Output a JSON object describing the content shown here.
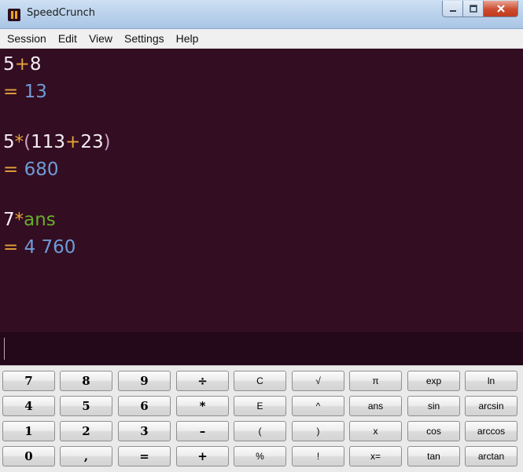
{
  "window": {
    "title": "SpeedCrunch",
    "controls": [
      "minimize",
      "maximize",
      "close"
    ]
  },
  "menu": [
    "Session",
    "Edit",
    "View",
    "Settings",
    "Help"
  ],
  "history": [
    {
      "expr": [
        {
          "t": "5",
          "k": "num"
        },
        {
          "t": "+",
          "k": "op"
        },
        {
          "t": "8",
          "k": "num"
        }
      ],
      "eq": "=",
      "result": "13"
    },
    {
      "expr": [
        {
          "t": "5",
          "k": "num"
        },
        {
          "t": "*",
          "k": "op"
        },
        {
          "t": "(",
          "k": "paren"
        },
        {
          "t": "113",
          "k": "num"
        },
        {
          "t": "+",
          "k": "op"
        },
        {
          "t": "23",
          "k": "num"
        },
        {
          "t": ")",
          "k": "paren"
        }
      ],
      "eq": "=",
      "result": "680"
    },
    {
      "expr": [
        {
          "t": "7",
          "k": "num"
        },
        {
          "t": "*",
          "k": "op"
        },
        {
          "t": "ans",
          "k": "ident"
        }
      ],
      "eq": "=",
      "result": "4 760"
    }
  ],
  "input": {
    "value": ""
  },
  "colors": {
    "display_bg": "#330d22",
    "input_bg": "#23091a",
    "number": "#f6eef3",
    "operator": "#e3a33a",
    "parenthesis": "#c9a1bf",
    "identifier": "#67ad2a",
    "result": "#6f9cd6"
  },
  "keypad": [
    [
      {
        "label": "7",
        "name": "digit-7"
      },
      {
        "label": "8",
        "name": "digit-8"
      },
      {
        "label": "9",
        "name": "digit-9"
      },
      {
        "label": "÷",
        "name": "divide"
      },
      {
        "label": "C",
        "name": "clear"
      },
      {
        "label": "√",
        "name": "sqrt"
      },
      {
        "label": "π",
        "name": "pi"
      },
      {
        "label": "exp",
        "name": "exp"
      },
      {
        "label": "ln",
        "name": "ln"
      }
    ],
    [
      {
        "label": "4",
        "name": "digit-4"
      },
      {
        "label": "5",
        "name": "digit-5"
      },
      {
        "label": "6",
        "name": "digit-6"
      },
      {
        "label": "*",
        "name": "multiply"
      },
      {
        "label": "E",
        "name": "exponent"
      },
      {
        "label": "^",
        "name": "power"
      },
      {
        "label": "ans",
        "name": "ans"
      },
      {
        "label": "sin",
        "name": "sin"
      },
      {
        "label": "arcsin",
        "name": "arcsin"
      }
    ],
    [
      {
        "label": "1",
        "name": "digit-1"
      },
      {
        "label": "2",
        "name": "digit-2"
      },
      {
        "label": "3",
        "name": "digit-3"
      },
      {
        "label": "–",
        "name": "subtract"
      },
      {
        "label": "(",
        "name": "open-paren"
      },
      {
        "label": ")",
        "name": "close-paren"
      },
      {
        "label": "x",
        "name": "variable-x"
      },
      {
        "label": "cos",
        "name": "cos"
      },
      {
        "label": "arccos",
        "name": "arccos"
      }
    ],
    [
      {
        "label": "0",
        "name": "digit-0"
      },
      {
        "label": ",",
        "name": "decimal"
      },
      {
        "label": "=",
        "name": "equals"
      },
      {
        "label": "+",
        "name": "add"
      },
      {
        "label": "%",
        "name": "percent"
      },
      {
        "label": "!",
        "name": "factorial"
      },
      {
        "label": "x=",
        "name": "assign-x"
      },
      {
        "label": "tan",
        "name": "tan"
      },
      {
        "label": "arctan",
        "name": "arctan"
      }
    ]
  ]
}
